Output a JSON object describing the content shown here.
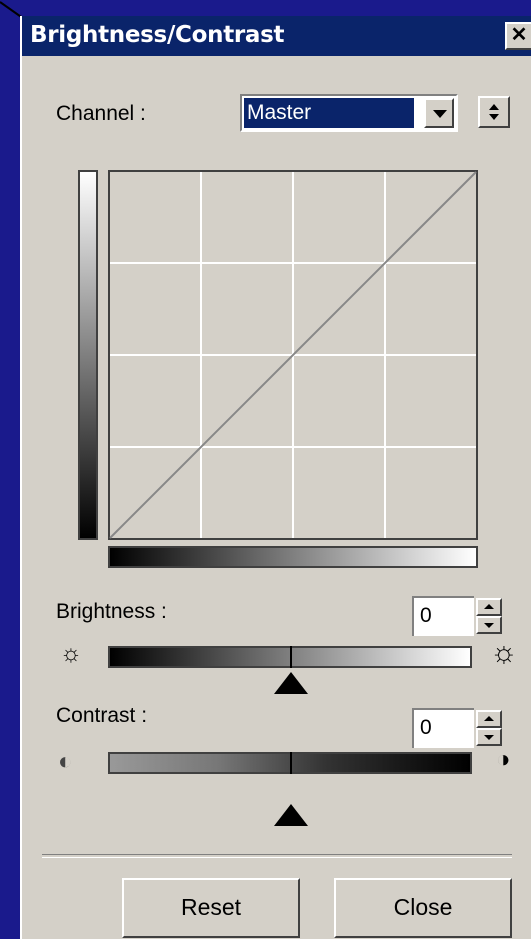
{
  "window": {
    "title": "Brightness/Contrast",
    "close_glyph": "✕"
  },
  "channel": {
    "label": "Channel :",
    "selected": "Master",
    "swap_glyph": "⇕"
  },
  "brightness": {
    "label": "Brightness :",
    "value": "0",
    "level": 0.5
  },
  "contrast": {
    "label": "Contrast :",
    "value": "0",
    "level": 0.5
  },
  "buttons": {
    "reset": "Reset",
    "close": "Close"
  },
  "icons": {
    "sun_small": "☼",
    "sun_large": "☼",
    "contrast_low": "◐",
    "contrast_high": "◑"
  },
  "colors": {
    "title_bg": "#0a246a",
    "face": "#d4d0c8",
    "desktop": "#1a1a8c"
  }
}
